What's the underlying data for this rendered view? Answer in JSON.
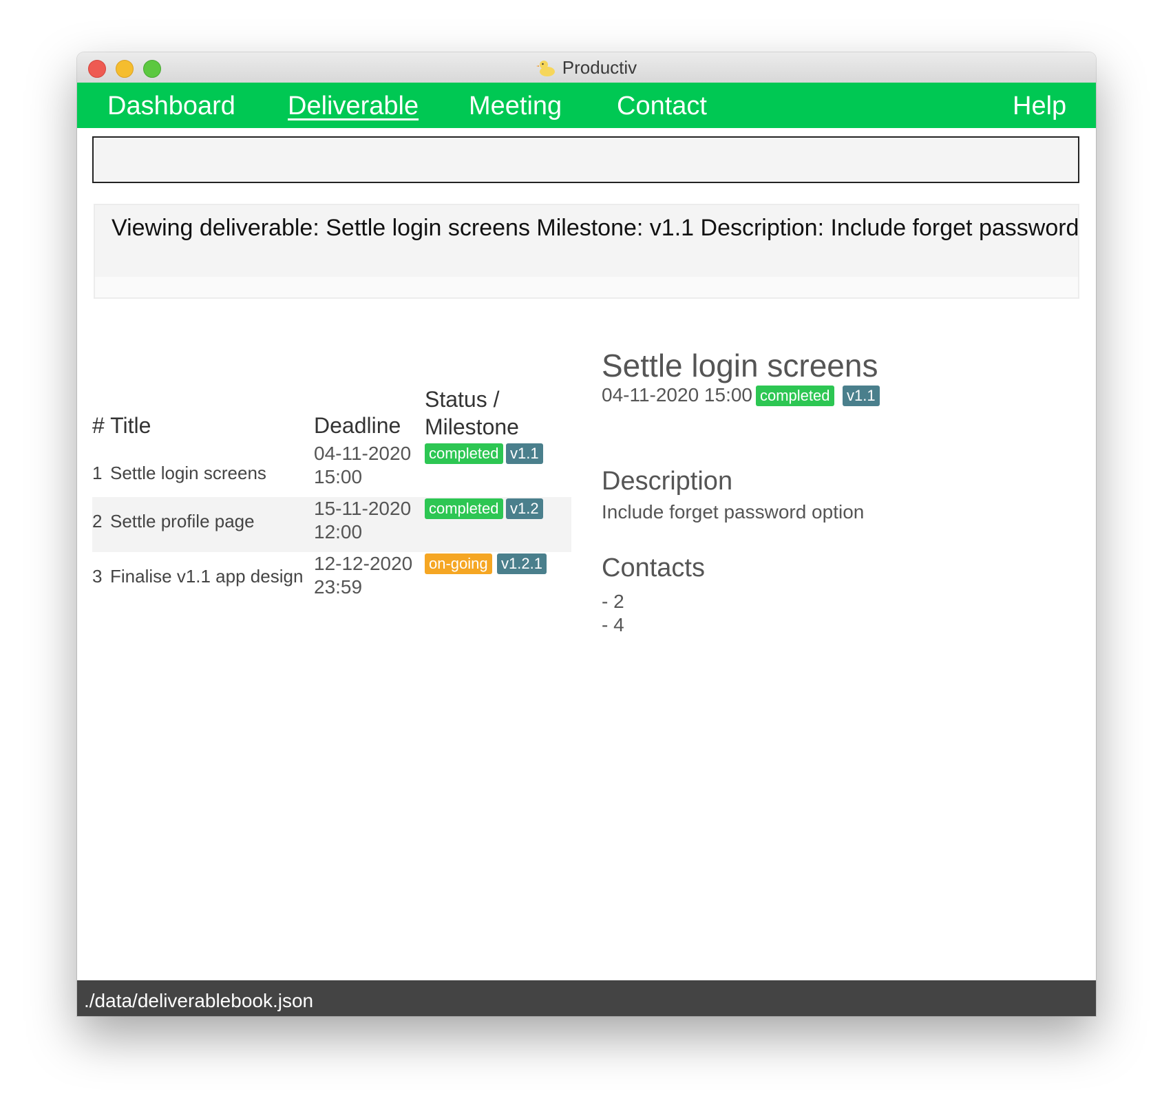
{
  "window": {
    "title": "Productiv",
    "app_icon": "duck-icon"
  },
  "menu": {
    "dashboard": "Dashboard",
    "deliverable": "Deliverable",
    "meeting": "Meeting",
    "contact": "Contact",
    "help": "Help",
    "active": "Deliverable"
  },
  "command": {
    "value": "",
    "placeholder": ""
  },
  "result": {
    "text": "Viewing deliverable: Settle login screens Milestone: v1.1 Description: Include forget password option"
  },
  "list": {
    "headers": {
      "index_title": "# Title",
      "deadline": "Deadline",
      "status_line1": "Status /",
      "status_line2": "Milestone"
    },
    "rows": [
      {
        "index": "1",
        "title": "Settle login screens",
        "date": "04-11-2020",
        "time": "15:00",
        "status": "completed",
        "milestone": "v1.1"
      },
      {
        "index": "2",
        "title": "Settle profile page",
        "date": "15-11-2020",
        "time": "12:00",
        "status": "completed",
        "milestone": "v1.2"
      },
      {
        "index": "3",
        "title": "Finalise v1.1 app design",
        "date": "12-12-2020",
        "time": "23:59",
        "status": "on-going",
        "milestone": "v1.2.1"
      }
    ]
  },
  "detail": {
    "title": "Settle login screens",
    "deadline": "04-11-2020 15:00",
    "status": "completed",
    "milestone": "v1.1",
    "description_heading": "Description",
    "description": "Include forget password option",
    "contacts_heading": "Contacts",
    "contacts": [
      "- 2",
      "- 4"
    ]
  },
  "status_bar": {
    "path": "./data/deliverablebook.json"
  },
  "colors": {
    "menu_bg": "#00c853",
    "status_completed": "#2dc653",
    "status_ongoing": "#f5a623",
    "milestone": "#4a7f8c",
    "status_bar_bg": "#444444"
  }
}
